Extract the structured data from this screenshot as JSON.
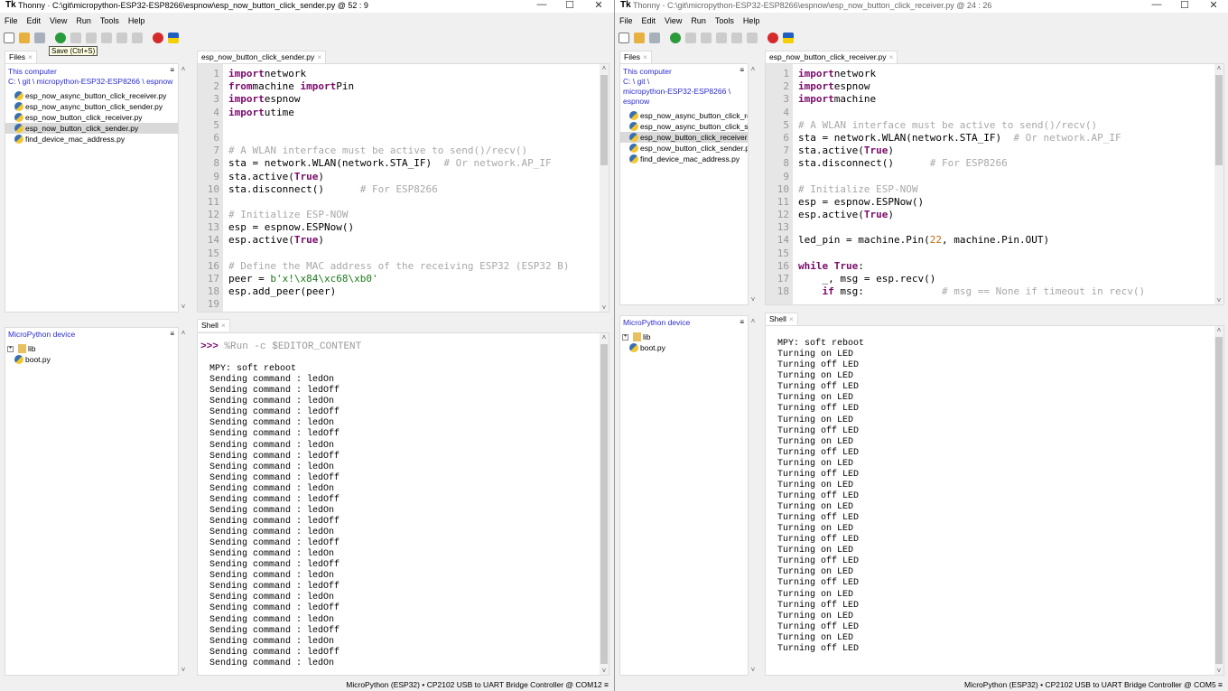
{
  "windows": [
    {
      "id": "sender",
      "app": "Thonny",
      "title": "C:\\git\\micropython-ESP32-ESP8266\\espnow\\esp_now_button_click_sender.py  @  52 : 9",
      "menu": [
        "File",
        "Edit",
        "View",
        "Run",
        "Tools",
        "Help"
      ],
      "tooltip": "Save (Ctrl+S)",
      "files_tab": "Files",
      "this_computer": "This computer",
      "path": [
        "C: \\ git \\ micropython-ESP32-ESP8266 \\ espnow"
      ],
      "files": [
        "esp_now_async_button_click_receiver.py",
        "esp_now_async_button_click_sender.py",
        "esp_now_button_click_receiver.py",
        "esp_now_button_click_sender.py",
        "find_device_mac_address.py"
      ],
      "selected_file": 3,
      "device_header": "MicroPython device",
      "device_items": [
        "lib",
        "boot.py"
      ],
      "editor_tab": "esp_now_button_click_sender.py",
      "code_start": 1,
      "code": [
        [
          [
            "kw",
            "import"
          ],
          [
            "",
            "network"
          ]
        ],
        [
          [
            "kw",
            "from"
          ],
          [
            "",
            "machine "
          ],
          [
            "kw",
            "import"
          ],
          [
            "",
            "Pin"
          ]
        ],
        [
          [
            "kw",
            "import"
          ],
          [
            "",
            "espnow"
          ]
        ],
        [
          [
            "kw",
            "import"
          ],
          [
            "",
            "utime"
          ]
        ],
        [],
        [],
        [
          [
            "cm",
            "# A WLAN interface must be active to send()/recv()"
          ]
        ],
        [
          [
            "",
            "sta = network.WLAN(network.STA_IF)  "
          ],
          [
            "cm",
            "# Or network.AP_IF"
          ]
        ],
        [
          [
            "",
            "sta.active("
          ],
          [
            "kw",
            "True"
          ],
          [
            "",
            ")"
          ]
        ],
        [
          [
            "",
            "sta.disconnect()      "
          ],
          [
            "cm",
            "# For ESP8266"
          ]
        ],
        [],
        [
          [
            "cm",
            "# Initialize ESP-NOW"
          ]
        ],
        [
          [
            "",
            "esp = espnow.ESPNow()"
          ]
        ],
        [
          [
            "",
            "esp.active("
          ],
          [
            "kw",
            "True"
          ],
          [
            "",
            ")"
          ]
        ],
        [],
        [
          [
            "cm",
            "# Define the MAC address of the receiving ESP32 (ESP32 B)"
          ]
        ],
        [
          [
            "",
            "peer = "
          ],
          [
            "st",
            "b'x!\\x84\\xc68\\xb0'"
          ]
        ],
        [
          [
            "",
            "esp.add_peer(peer)"
          ]
        ],
        []
      ],
      "shell_tab": "Shell",
      "shell_prompt": ">>>",
      "shell_command": "%Run -c $EDITOR_CONTENT",
      "shell_output": [
        "MPY: soft reboot",
        "Sending command : ledOn",
        "Sending command : ledOff",
        "Sending command : ledOn",
        "Sending command : ledOff",
        "Sending command : ledOn",
        "Sending command : ledOff",
        "Sending command : ledOn",
        "Sending command : ledOff",
        "Sending command : ledOn",
        "Sending command : ledOff",
        "Sending command : ledOn",
        "Sending command : ledOff",
        "Sending command : ledOn",
        "Sending command : ledOff",
        "Sending command : ledOn",
        "Sending command : ledOff",
        "Sending command : ledOn",
        "Sending command : ledOff",
        "Sending command : ledOn",
        "Sending command : ledOff",
        "Sending command : ledOn",
        "Sending command : ledOff",
        "Sending command : ledOn",
        "Sending command : ledOff",
        "Sending command : ledOn",
        "Sending command : ledOff",
        "Sending command : ledOn"
      ],
      "status": "MicroPython (ESP32)  •  CP2102 USB to UART Bridge Controller @ COM12  ≡"
    },
    {
      "id": "receiver",
      "app": "Thonny",
      "title": "C:\\git\\micropython-ESP32-ESP8266\\espnow\\esp_now_button_click_receiver.py  @  24 : 26",
      "menu": [
        "File",
        "Edit",
        "View",
        "Run",
        "Tools",
        "Help"
      ],
      "files_tab": "Files",
      "this_computer": "This computer",
      "path": [
        "C: \\ git \\",
        "micropython-ESP32-ESP8266 \\",
        "espnow"
      ],
      "files": [
        "esp_now_async_button_click_re",
        "esp_now_async_button_click_se",
        "esp_now_button_click_receiver.",
        "esp_now_button_click_sender.p",
        "find_device_mac_address.py"
      ],
      "selected_file": 2,
      "device_header": "MicroPython device",
      "device_items": [
        "lib",
        "boot.py"
      ],
      "editor_tab": "esp_now_button_click_receiver.py",
      "code_start": 1,
      "code": [
        [
          [
            "kw",
            "import"
          ],
          [
            "",
            "network"
          ]
        ],
        [
          [
            "kw",
            "import"
          ],
          [
            "",
            "espnow"
          ]
        ],
        [
          [
            "kw",
            "import"
          ],
          [
            "",
            "machine"
          ]
        ],
        [],
        [
          [
            "cm",
            "# A WLAN interface must be active to send()/recv()"
          ]
        ],
        [
          [
            "",
            "sta = network.WLAN(network.STA_IF)  "
          ],
          [
            "cm",
            "# Or network.AP_IF"
          ]
        ],
        [
          [
            "",
            "sta.active("
          ],
          [
            "kw",
            "True"
          ],
          [
            "",
            ")"
          ]
        ],
        [
          [
            "",
            "sta.disconnect()      "
          ],
          [
            "cm",
            "# For ESP8266"
          ]
        ],
        [],
        [
          [
            "cm",
            "# Initialize ESP-NOW"
          ]
        ],
        [
          [
            "",
            "esp = espnow.ESPNow()"
          ]
        ],
        [
          [
            "",
            "esp.active("
          ],
          [
            "kw",
            "True"
          ],
          [
            "",
            ")"
          ]
        ],
        [],
        [
          [
            "",
            "led_pin = machine.Pin("
          ],
          [
            "nm",
            "22"
          ],
          [
            "",
            ", machine.Pin.OUT)"
          ]
        ],
        [],
        [
          [
            "kw",
            "while"
          ],
          [
            "",
            " "
          ],
          [
            "kw",
            "True"
          ],
          [
            "",
            ":"
          ]
        ],
        [
          [
            "",
            "    _, msg = esp.recv()"
          ]
        ],
        [
          [
            "",
            "    "
          ],
          [
            "kw",
            "if"
          ],
          [
            "",
            " msg:             "
          ],
          [
            "cm",
            "# msg == None if timeout in recv()"
          ]
        ]
      ],
      "shell_tab": "Shell",
      "shell_prompt": ">>>",
      "shell_command": "%Run -c $EDITOR_CONTENT",
      "shell_output": [
        "MPY: soft reboot",
        "Turning on LED",
        "Turning off LED",
        "Turning on LED",
        "Turning off LED",
        "Turning on LED",
        "Turning off LED",
        "Turning on LED",
        "Turning off LED",
        "Turning on LED",
        "Turning off LED",
        "Turning on LED",
        "Turning off LED",
        "Turning on LED",
        "Turning off LED",
        "Turning on LED",
        "Turning off LED",
        "Turning on LED",
        "Turning off LED",
        "Turning on LED",
        "Turning off LED",
        "Turning on LED",
        "Turning off LED",
        "Turning on LED",
        "Turning off LED",
        "Turning on LED",
        "Turning off LED",
        "Turning on LED",
        "Turning off LED"
      ],
      "status": "MicroPython (ESP32)  •  CP2102 USB to UART Bridge Controller @ COM5  ≡"
    }
  ],
  "colors": {
    "keyword": "#7a0a6a",
    "comment": "#a8a8a8",
    "string": "#1e7a1e",
    "number": "#c06a10",
    "link": "#2b2bd0"
  }
}
